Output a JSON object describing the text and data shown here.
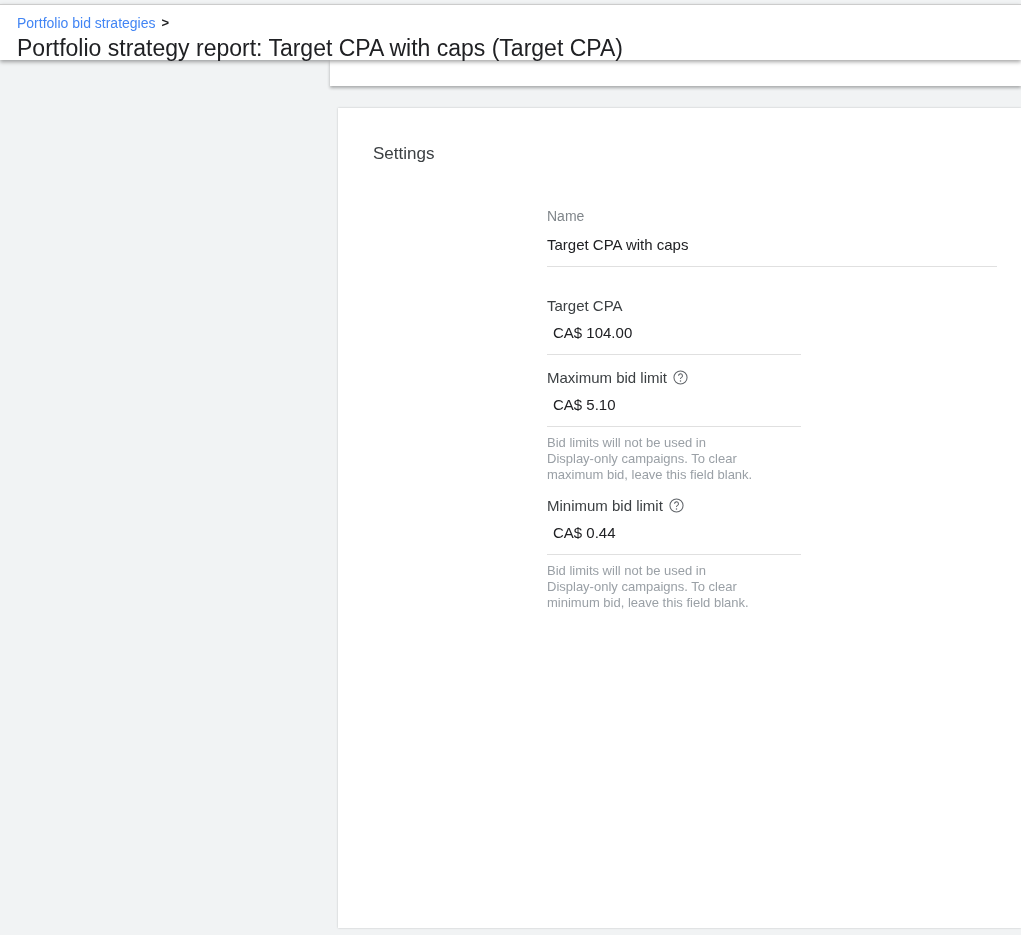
{
  "breadcrumb": {
    "link": "Portfolio bid strategies",
    "separator": ">"
  },
  "page_title": "Portfolio strategy report: Target CPA with caps (Target CPA)",
  "settings": {
    "title": "Settings",
    "fields": [
      {
        "kind": "text",
        "label": "Name",
        "value": "Target CPA with caps",
        "help_icon": false
      },
      {
        "kind": "currency",
        "label": "Target CPA",
        "value": "CA$ 104.00",
        "help_icon": false
      },
      {
        "kind": "currency",
        "label": "Maximum bid limit",
        "value": "CA$ 5.10",
        "help_icon": true,
        "hint": "Bid limits will not be used in Display-only campaigns. To clear maximum bid, leave this field blank."
      },
      {
        "kind": "currency",
        "label": "Minimum bid limit",
        "value": "CA$ 0.44",
        "help_icon": true,
        "hint": "Bid limits will not be used in Display-only campaigns. To clear minimum bid, leave this field blank."
      }
    ]
  }
}
